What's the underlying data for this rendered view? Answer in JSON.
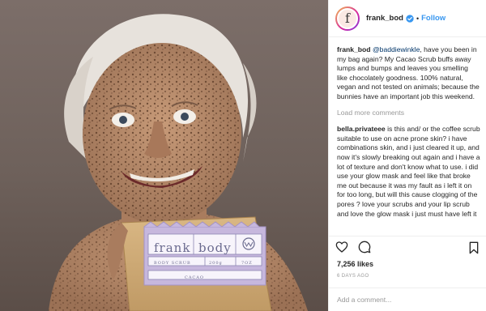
{
  "post": {
    "username": "frank_bod",
    "avatar_letter": "f",
    "follow_label": "Follow",
    "separator": "•",
    "caption": {
      "user": "frank_bod",
      "mention": "@baddiewinkle",
      "text": ", have you been in my bag again? My Cacao Scrub buffs away lumps and bumps and leaves you smelling like chocolately goodness. 100% natural, vegan and not tested on animals; because the bunnies have an important job this weekend."
    },
    "load_more_label": "Load more comments",
    "comments": [
      {
        "user": "bella.privateee",
        "text": "is this and/ or the coffee scrub suitable to use on acne prone skin? i have combinations skin, and i just cleared it up, and now it's slowly breaking out again and i have a lot of texture and don't know what to use. i did use your glow mask and feel like that broke me out because it was my fault as i left it on for too long, but will this cause clogging of the pores ? love your scrubs and your lip scrub and love the glow mask i just must have left it"
      }
    ],
    "likes": "7,256 likes",
    "time_ago": "6 DAYS AGO",
    "comment_placeholder": "Add a comment..."
  },
  "product": {
    "brand": "frank",
    "brand2": "body",
    "line": "BODY SCRUB",
    "weight": "200g",
    "weight2": "7OZ",
    "flavor": "CACAO"
  },
  "icons": {
    "verified": "verified-badge-icon",
    "like": "heart-icon",
    "comment": "comment-bubble-icon",
    "save": "bookmark-icon"
  },
  "colors": {
    "follow": "#3897f0",
    "mention": "#003569",
    "muted": "#999999",
    "verified": "#3897f0"
  }
}
